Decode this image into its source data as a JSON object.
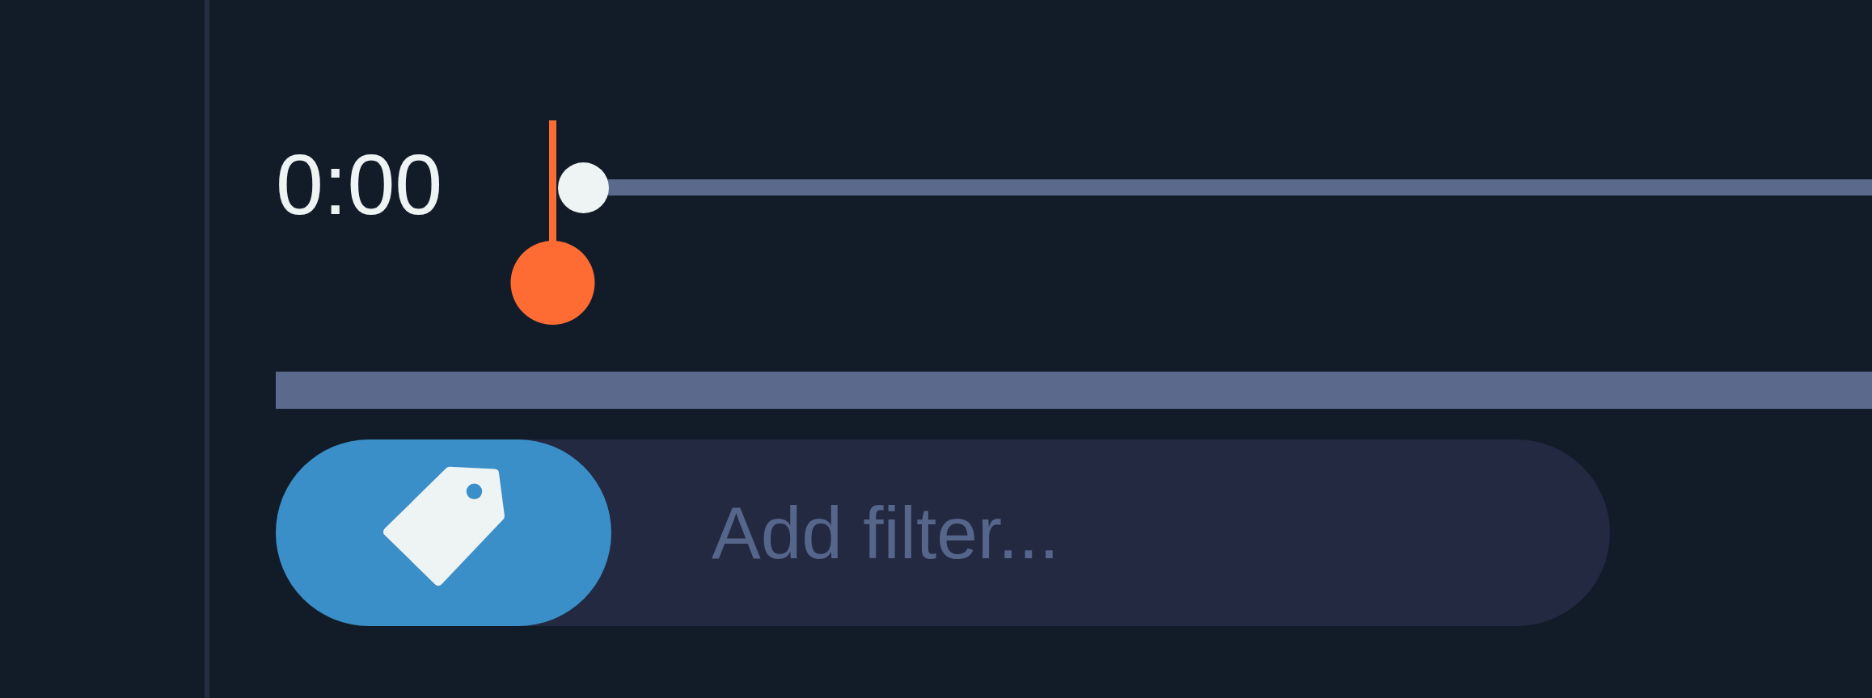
{
  "time_display": "0:00",
  "seek_slider": {
    "level": 0
  },
  "filter": {
    "placeholder": "Add filter..."
  }
}
